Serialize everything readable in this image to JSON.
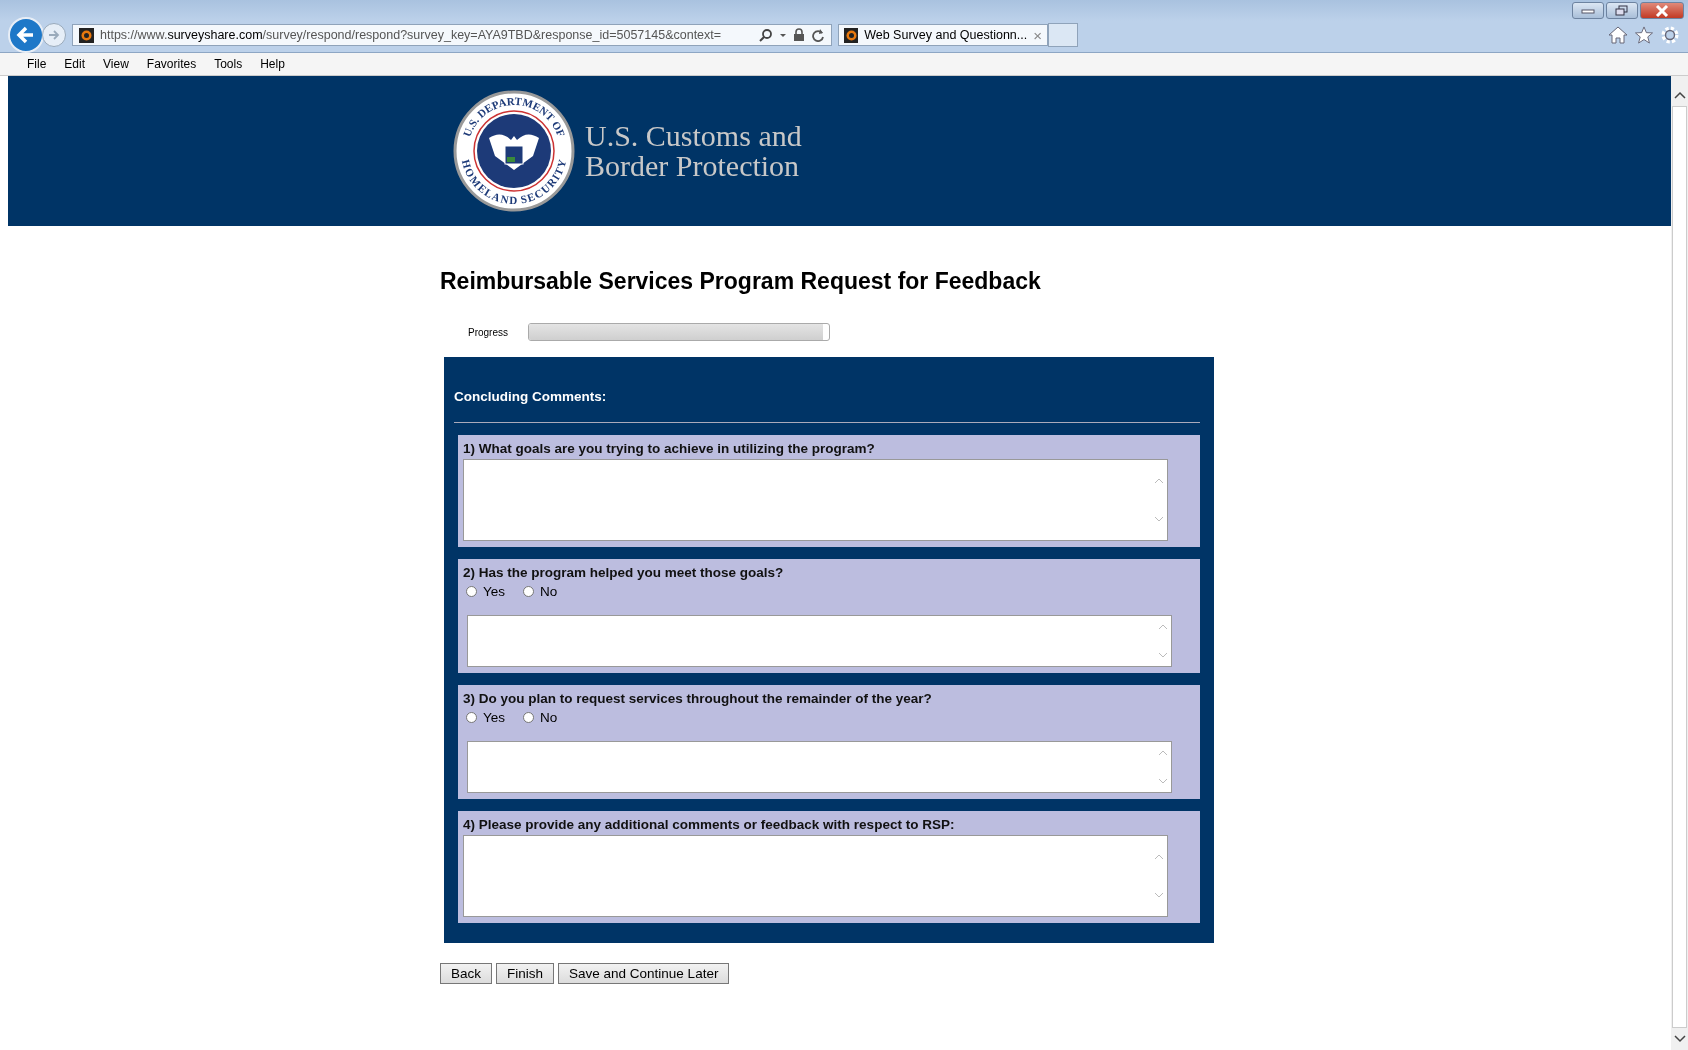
{
  "browser": {
    "url_prefix": "https://www.",
    "url_domain": "surveyshare.com",
    "url_rest": "/survey/respond/respond?survey_key=AYA9TBD&response_id=5057145&context=",
    "tab": {
      "title": "Web Survey and Questionn...",
      "close": "×",
      "selected": true
    },
    "menu": [
      "File",
      "Edit",
      "View",
      "Favorites",
      "Tools",
      "Help"
    ]
  },
  "banner": {
    "seal_top": "U.S. DEPARTMENT OF",
    "seal_bottom": "HOMELAND SECURITY",
    "agency_line1": "U.S. Customs and",
    "agency_line2": "Border Protection"
  },
  "title": "Reimbursable Services Program Request for Feedback",
  "progress": {
    "label": "Progress",
    "level": 0.98
  },
  "section": {
    "heading": "Concluding Comments:",
    "questions": [
      {
        "kind": "text",
        "prompt": "1) What goals are you trying to achieve in utilizing the program?"
      },
      {
        "kind": "yesno",
        "prompt": "2) Has the program helped you meet those goals?",
        "options": [
          {
            "label": "Yes",
            "selected": false
          },
          {
            "label": "No",
            "selected": false
          }
        ]
      },
      {
        "kind": "yesno",
        "prompt": "3) Do you plan to request services throughout the remainder of the year?",
        "options": [
          {
            "label": "Yes",
            "selected": false
          },
          {
            "label": "No",
            "selected": false
          }
        ]
      },
      {
        "kind": "text",
        "prompt": "4) Please provide any additional comments or feedback with respect to RSP:"
      }
    ]
  },
  "buttons": [
    "Back",
    "Finish",
    "Save and Continue Later"
  ]
}
